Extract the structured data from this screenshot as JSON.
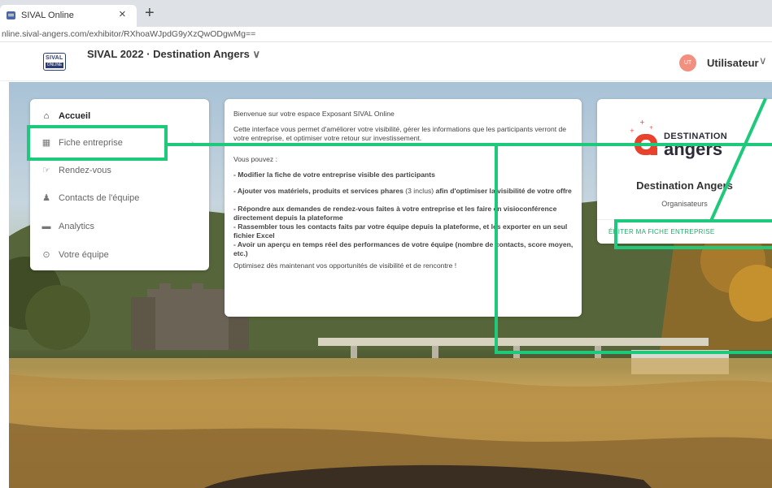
{
  "browser": {
    "tab_title": "SIVAL Online",
    "tab_close": "×",
    "new_tab": "+",
    "url": "nline.sival-angers.com/exhibitor/RXhoaWJpdG9yXzQwODgwMg=="
  },
  "header": {
    "logo_top": "SIVAL",
    "logo_bottom": "ONLINE",
    "title": "SIVAL 2022 · Destination Angers",
    "title_chevron": "∨",
    "avatar_initials": "UT",
    "user_name": "Utilisateur",
    "user_chevron": "∨"
  },
  "menu": {
    "items": [
      {
        "label": "Accueil",
        "icon": "home-icon",
        "glyph": "⌂"
      },
      {
        "label": "Fiche entreprise",
        "icon": "building-icon",
        "glyph": "▦"
      },
      {
        "label": "Rendez-vous",
        "icon": "handshake-icon",
        "glyph": "☞"
      },
      {
        "label": "Contacts de l'équipe",
        "icon": "team-icon",
        "glyph": "♟"
      },
      {
        "label": "Analytics",
        "icon": "chart-icon",
        "glyph": "▬"
      },
      {
        "label": "Votre équipe",
        "icon": "team-settings-icon",
        "glyph": "⊙"
      }
    ],
    "arrow": "›"
  },
  "welcome": {
    "intro": "Bienvenue sur votre espace Exposant SIVAL Online",
    "desc": "Cette interface vous permet d'améliorer votre visibilité, gérer les informations que les participants verront de votre entreprise, et optimiser votre retour sur investissement.",
    "you_can": "Vous pouvez :",
    "b1": "- Modifier la fiche de votre entreprise visible des participants",
    "b2a": "- Ajouter vos matériels, produits et services phares",
    "b2b": "(3 inclus)",
    "b2c": "afin d'optimiser la visibilité de votre offre",
    "b3": "- Répondre aux demandes de rendez-vous faites à votre entreprise et les faire en visioconférence directement depuis la plateforme",
    "b4": "- Rassembler tous les contacts faits par votre équipe depuis la plateforme, et les exporter en un seul fichier Excel",
    "b5": "- Avoir un aperçu en temps réel des performances de votre équipe (nombre de contacts, score moyen, etc.)",
    "outro": "Optimisez dès maintenant vos opportunités de visibilité et de rencontre !"
  },
  "company": {
    "logo_line1": "DESTINATION",
    "logo_line2": "angers",
    "name": "Destination Angers",
    "role": "Organisateurs",
    "edit_label": "ÉDITER MA FICHE ENTREPRISE"
  },
  "colors": {
    "highlight": "#1fc97c",
    "accent_green": "#26a86b",
    "logo_red": "#e8412c",
    "avatar": "#f28f7e"
  }
}
